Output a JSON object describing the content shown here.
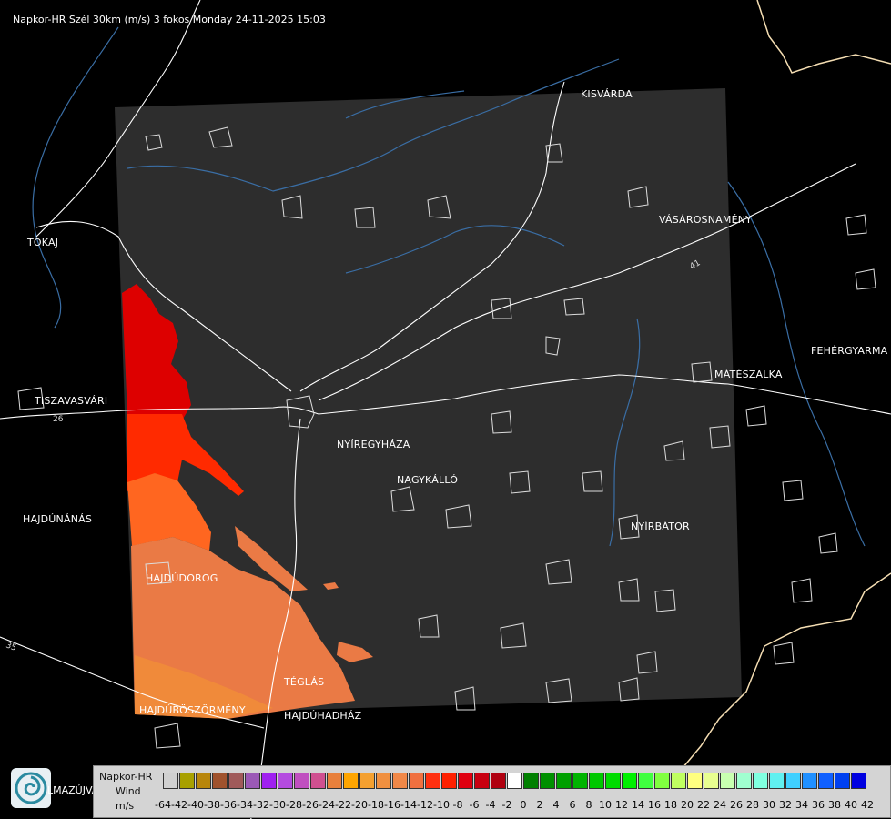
{
  "header": {
    "title": "Napkor-HR Szél 30km (m/s) 3 fokos Monday 24-11-2025 15:03"
  },
  "cities": [
    {
      "key": "kisvarda",
      "name": "KISVÁRDA"
    },
    {
      "key": "vasarosnameny",
      "name": "VÁSÁROSNAMÉNY"
    },
    {
      "key": "tokaj",
      "name": "TOKAJ"
    },
    {
      "key": "fehergyarmat",
      "name": "FEHÉRGYARMA"
    },
    {
      "key": "mateszalka",
      "name": "MÁTÉSZALKA"
    },
    {
      "key": "tiszavasvari",
      "name": "TISZAVASVÁRI"
    },
    {
      "key": "nyiregyhaza",
      "name": "NYÍREGYHÁZA"
    },
    {
      "key": "nagykallo",
      "name": "NAGYKÁLLÓ"
    },
    {
      "key": "nyirbator",
      "name": "NYÍRBÁTOR"
    },
    {
      "key": "hajdunanas",
      "name": "HAJDÚNÁNÁS"
    },
    {
      "key": "hajdudorog",
      "name": "HAJDÚDOROG"
    },
    {
      "key": "teglas",
      "name": "TÉGLÁS"
    },
    {
      "key": "hajduboszormeny",
      "name": "HAJDÚBÖSZÖRMÉNY"
    },
    {
      "key": "hajduhadhaz",
      "name": "HAJDÚHADHÁZ"
    }
  ],
  "road_numbers": [
    "26",
    "35",
    "41"
  ],
  "logo": {
    "icon": "napkor-swirl-logo-icon",
    "text": "LMAZÚJVÁR"
  },
  "legend": {
    "line1": "Napkor-HR",
    "line2": "Wind",
    "unit": "m/s",
    "ticks": [
      "-64",
      "-42",
      "-40",
      "-38",
      "-36",
      "-34",
      "-32",
      "-30",
      "-28",
      "-26",
      "-24",
      "-22",
      "-20",
      "-18",
      "-16",
      "-14",
      "-12",
      "-10",
      "-8",
      "-6",
      "-4",
      "-2",
      "0",
      "2",
      "4",
      "6",
      "8",
      "10",
      "12",
      "14",
      "16",
      "18",
      "20",
      "22",
      "24",
      "26",
      "28",
      "30",
      "32",
      "34",
      "36",
      "38",
      "40",
      "42"
    ],
    "colors": [
      "#d0d0d0",
      "#a8a000",
      "#b8860b",
      "#a0522d",
      "#a05a5a",
      "#9b59b6",
      "#a020f0",
      "#b44be0",
      "#c050c0",
      "#d05090",
      "#e8803c",
      "#ffa500",
      "#f4a030",
      "#f09040",
      "#f08848",
      "#f07040",
      "#ff3010",
      "#ff2000",
      "#e00010",
      "#c80010",
      "#b00010",
      "#ffffff",
      "#008000",
      "#009000",
      "#00a000",
      "#00b400",
      "#00c800",
      "#00dc00",
      "#00f000",
      "#40ff40",
      "#80ff40",
      "#c0ff60",
      "#ffff80",
      "#e8ff90",
      "#c8ffb0",
      "#a0ffd0",
      "#80ffe0",
      "#60f0f0",
      "#40d0ff",
      "#2090ff",
      "#1060ff",
      "#0040f0",
      "#0000e0"
    ]
  },
  "map": {
    "model_area_color": "#2d2d2d",
    "wind_colors": {
      "strong": "#dd0000",
      "mid": "#ff3300",
      "orange": "#ff6620",
      "light": "#ef7b40",
      "lightest": "#f0873e"
    },
    "river_color": "#3a6ea5",
    "border_color": "#f5deb3"
  }
}
